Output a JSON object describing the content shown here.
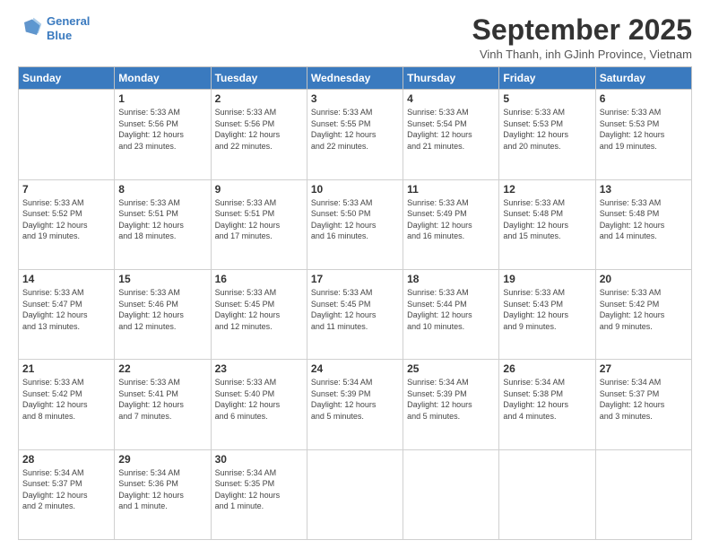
{
  "logo": {
    "line1": "General",
    "line2": "Blue"
  },
  "title": "September 2025",
  "subtitle": "Vinh Thanh, inh GJinh Province, Vietnam",
  "days_of_week": [
    "Sunday",
    "Monday",
    "Tuesday",
    "Wednesday",
    "Thursday",
    "Friday",
    "Saturday"
  ],
  "weeks": [
    [
      {
        "day": "",
        "info": ""
      },
      {
        "day": "1",
        "info": "Sunrise: 5:33 AM\nSunset: 5:56 PM\nDaylight: 12 hours\nand 23 minutes."
      },
      {
        "day": "2",
        "info": "Sunrise: 5:33 AM\nSunset: 5:56 PM\nDaylight: 12 hours\nand 22 minutes."
      },
      {
        "day": "3",
        "info": "Sunrise: 5:33 AM\nSunset: 5:55 PM\nDaylight: 12 hours\nand 22 minutes."
      },
      {
        "day": "4",
        "info": "Sunrise: 5:33 AM\nSunset: 5:54 PM\nDaylight: 12 hours\nand 21 minutes."
      },
      {
        "day": "5",
        "info": "Sunrise: 5:33 AM\nSunset: 5:53 PM\nDaylight: 12 hours\nand 20 minutes."
      },
      {
        "day": "6",
        "info": "Sunrise: 5:33 AM\nSunset: 5:53 PM\nDaylight: 12 hours\nand 19 minutes."
      }
    ],
    [
      {
        "day": "7",
        "info": "Sunrise: 5:33 AM\nSunset: 5:52 PM\nDaylight: 12 hours\nand 19 minutes."
      },
      {
        "day": "8",
        "info": "Sunrise: 5:33 AM\nSunset: 5:51 PM\nDaylight: 12 hours\nand 18 minutes."
      },
      {
        "day": "9",
        "info": "Sunrise: 5:33 AM\nSunset: 5:51 PM\nDaylight: 12 hours\nand 17 minutes."
      },
      {
        "day": "10",
        "info": "Sunrise: 5:33 AM\nSunset: 5:50 PM\nDaylight: 12 hours\nand 16 minutes."
      },
      {
        "day": "11",
        "info": "Sunrise: 5:33 AM\nSunset: 5:49 PM\nDaylight: 12 hours\nand 16 minutes."
      },
      {
        "day": "12",
        "info": "Sunrise: 5:33 AM\nSunset: 5:48 PM\nDaylight: 12 hours\nand 15 minutes."
      },
      {
        "day": "13",
        "info": "Sunrise: 5:33 AM\nSunset: 5:48 PM\nDaylight: 12 hours\nand 14 minutes."
      }
    ],
    [
      {
        "day": "14",
        "info": "Sunrise: 5:33 AM\nSunset: 5:47 PM\nDaylight: 12 hours\nand 13 minutes."
      },
      {
        "day": "15",
        "info": "Sunrise: 5:33 AM\nSunset: 5:46 PM\nDaylight: 12 hours\nand 12 minutes."
      },
      {
        "day": "16",
        "info": "Sunrise: 5:33 AM\nSunset: 5:45 PM\nDaylight: 12 hours\nand 12 minutes."
      },
      {
        "day": "17",
        "info": "Sunrise: 5:33 AM\nSunset: 5:45 PM\nDaylight: 12 hours\nand 11 minutes."
      },
      {
        "day": "18",
        "info": "Sunrise: 5:33 AM\nSunset: 5:44 PM\nDaylight: 12 hours\nand 10 minutes."
      },
      {
        "day": "19",
        "info": "Sunrise: 5:33 AM\nSunset: 5:43 PM\nDaylight: 12 hours\nand 9 minutes."
      },
      {
        "day": "20",
        "info": "Sunrise: 5:33 AM\nSunset: 5:42 PM\nDaylight: 12 hours\nand 9 minutes."
      }
    ],
    [
      {
        "day": "21",
        "info": "Sunrise: 5:33 AM\nSunset: 5:42 PM\nDaylight: 12 hours\nand 8 minutes."
      },
      {
        "day": "22",
        "info": "Sunrise: 5:33 AM\nSunset: 5:41 PM\nDaylight: 12 hours\nand 7 minutes."
      },
      {
        "day": "23",
        "info": "Sunrise: 5:33 AM\nSunset: 5:40 PM\nDaylight: 12 hours\nand 6 minutes."
      },
      {
        "day": "24",
        "info": "Sunrise: 5:34 AM\nSunset: 5:39 PM\nDaylight: 12 hours\nand 5 minutes."
      },
      {
        "day": "25",
        "info": "Sunrise: 5:34 AM\nSunset: 5:39 PM\nDaylight: 12 hours\nand 5 minutes."
      },
      {
        "day": "26",
        "info": "Sunrise: 5:34 AM\nSunset: 5:38 PM\nDaylight: 12 hours\nand 4 minutes."
      },
      {
        "day": "27",
        "info": "Sunrise: 5:34 AM\nSunset: 5:37 PM\nDaylight: 12 hours\nand 3 minutes."
      }
    ],
    [
      {
        "day": "28",
        "info": "Sunrise: 5:34 AM\nSunset: 5:37 PM\nDaylight: 12 hours\nand 2 minutes."
      },
      {
        "day": "29",
        "info": "Sunrise: 5:34 AM\nSunset: 5:36 PM\nDaylight: 12 hours\nand 1 minute."
      },
      {
        "day": "30",
        "info": "Sunrise: 5:34 AM\nSunset: 5:35 PM\nDaylight: 12 hours\nand 1 minute."
      },
      {
        "day": "",
        "info": ""
      },
      {
        "day": "",
        "info": ""
      },
      {
        "day": "",
        "info": ""
      },
      {
        "day": "",
        "info": ""
      }
    ]
  ]
}
